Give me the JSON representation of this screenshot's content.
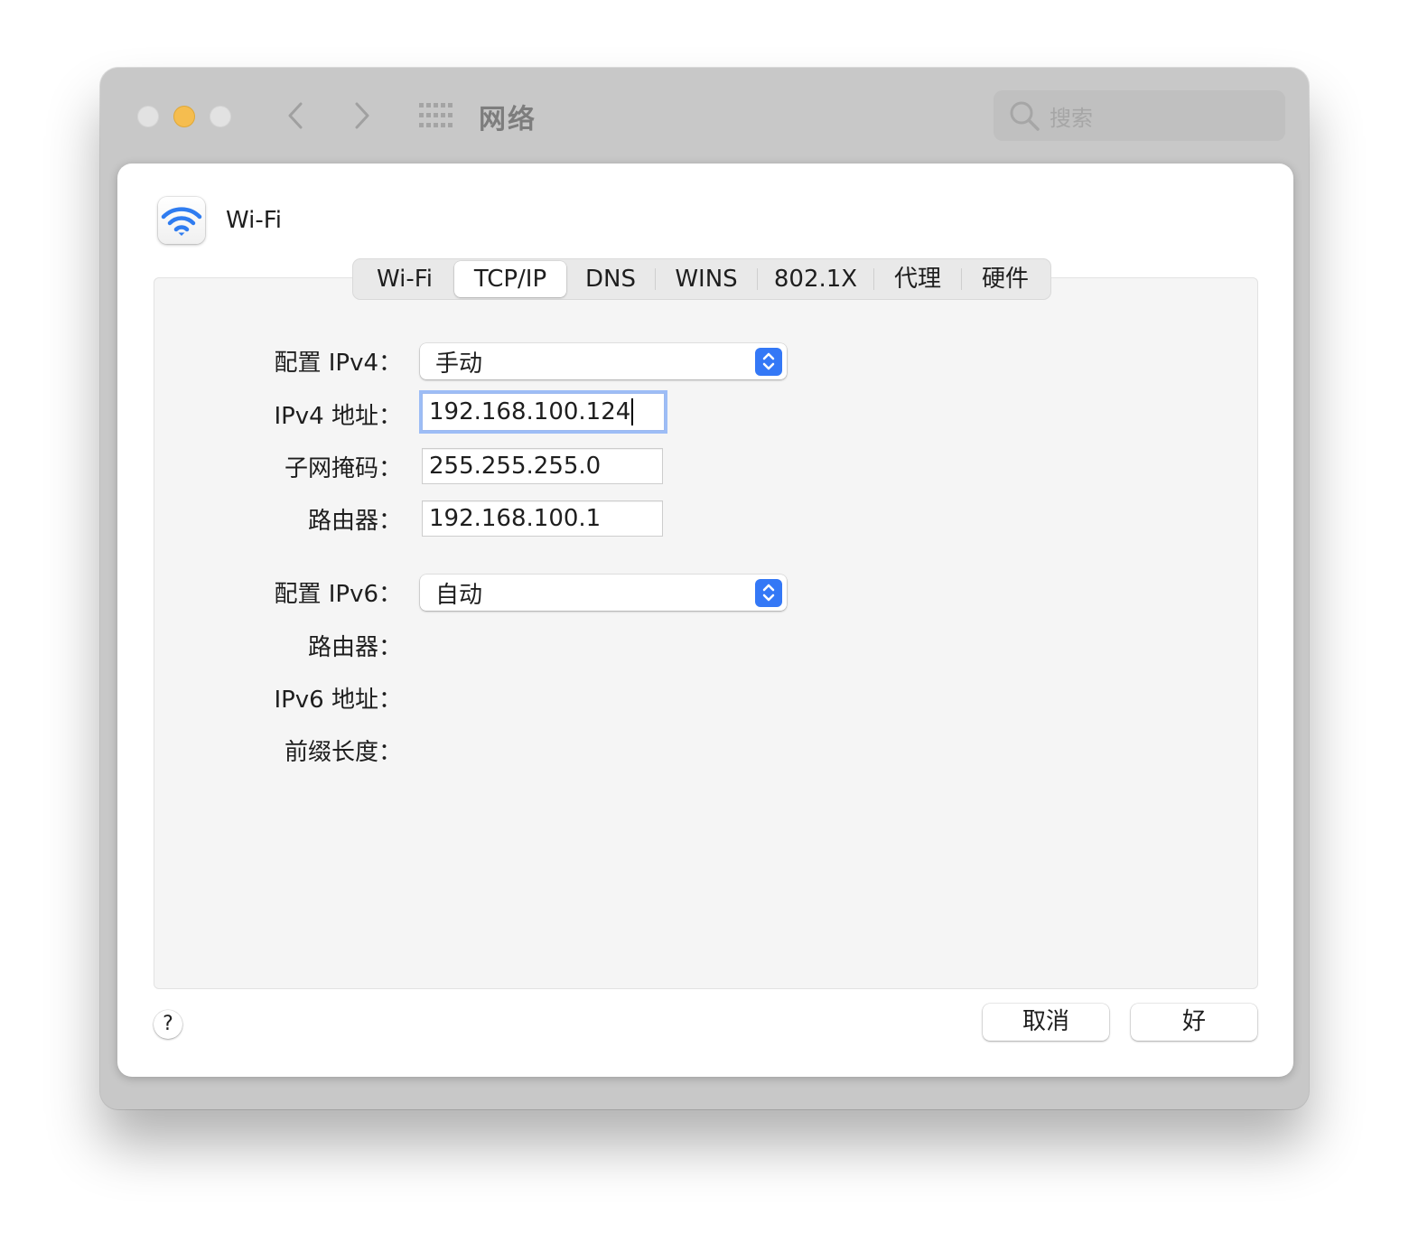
{
  "window": {
    "title": "网络",
    "search_placeholder": "搜索",
    "icons": {
      "back": "chevron-left-icon",
      "forward": "chevron-right-icon",
      "show_all": "grid-icon",
      "search": "magnifier-icon"
    }
  },
  "sheet": {
    "interface_name": "Wi-Fi",
    "interface_icon": "wifi-icon",
    "tabs": [
      {
        "label": "Wi-Fi",
        "active": false
      },
      {
        "label": "TCP/IP",
        "active": true
      },
      {
        "label": "DNS",
        "active": false
      },
      {
        "label": "WINS",
        "active": false
      },
      {
        "label": "802.1X",
        "active": false
      },
      {
        "label": "代理",
        "active": false
      },
      {
        "label": "硬件",
        "active": false
      }
    ],
    "ipv4": {
      "config_label": "配置 IPv4：",
      "config_value": "手动",
      "address_label": "IPv4 地址：",
      "address_value": "192.168.100.124",
      "subnet_label": "子网掩码：",
      "subnet_value": "255.255.255.0",
      "router_label": "路由器：",
      "router_value": "192.168.100.1"
    },
    "ipv6": {
      "config_label": "配置 IPv6：",
      "config_value": "自动",
      "router_label": "路由器：",
      "address_label": "IPv6 地址：",
      "prefix_label": "前缀长度："
    },
    "help_label": "?",
    "cancel_label": "取消",
    "ok_label": "好"
  },
  "colors": {
    "accent": "#3478f6",
    "focus_ring": "#9dbdf6",
    "minimize_light": "#f5bd4f",
    "titlebar": "#c8c8c8"
  }
}
